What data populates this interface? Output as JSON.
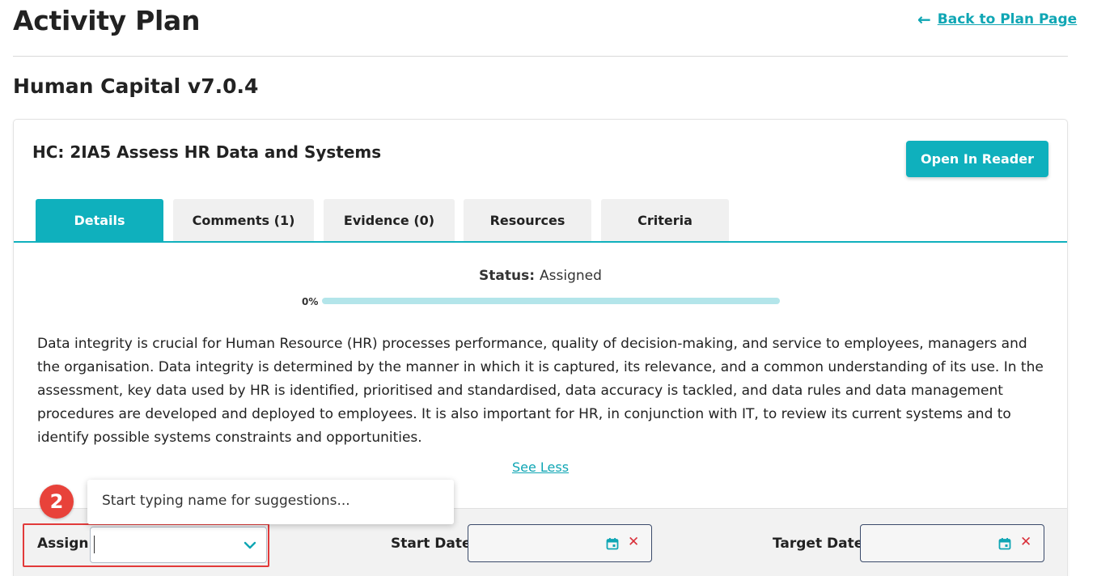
{
  "header": {
    "title": "Activity Plan",
    "back_link": "Back to Plan Page"
  },
  "plan": {
    "name": "Human Capital v7.0.4"
  },
  "activity": {
    "title": "HC: 2IA5 Assess HR Data and Systems",
    "open_reader_label": "Open In Reader"
  },
  "tabs": [
    {
      "label": "Details",
      "active": true
    },
    {
      "label": "Comments (1)",
      "active": false
    },
    {
      "label": "Evidence (0)",
      "active": false
    },
    {
      "label": "Resources",
      "active": false
    },
    {
      "label": "Criteria",
      "active": false
    }
  ],
  "status": {
    "label": "Status:",
    "value": "Assigned",
    "progress_label": "0%",
    "progress_fraction": 0
  },
  "description": "Data integrity is crucial for Human Resource (HR) processes performance, quality of decision-making, and service to employees, managers and the organisation. Data integrity is determined by the manner in which it is captured, its relevance, and a common understanding of its use. In the assessment, key data used by HR is identified, prioritised and standardised, data accuracy is tackled, and data rules and data management procedures are developed and deployed to employees. It is also important for HR, in conjunction with IT, to review its current systems and to identify possible systems constraints and opportunities.",
  "see_less": "See Less",
  "assign": {
    "label": "Assign",
    "value": "",
    "suggestion_hint": "Start typing name for suggestions..."
  },
  "dates": {
    "start_label": "Start Date",
    "start_value": "",
    "target_label": "Target Date",
    "target_value": ""
  },
  "annotation": {
    "step_number": "2",
    "highlight_color": "#e23a3a"
  },
  "colors": {
    "accent": "#0fb0bd",
    "link": "#0fa6b4",
    "danger": "#d9303a"
  },
  "icons": {
    "back": "arrow-left-icon",
    "dropdown": "chevron-down-icon",
    "calendar": "calendar-icon",
    "clear": "close-icon"
  }
}
